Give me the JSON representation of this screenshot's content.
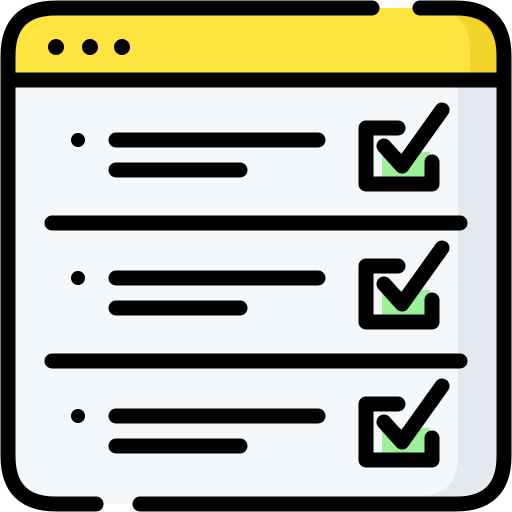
{
  "icon": {
    "name": "checklist-browser-window-icon",
    "colors": {
      "outline": "#000000",
      "title_bar": "#ffe33f",
      "title_bar_shade": "#f4d428",
      "window_body": "#f4f8fb",
      "window_shade": "#e3e9ee",
      "checkbox_fill": "#9df09a"
    },
    "window_controls": [
      "dot",
      "dot",
      "dot"
    ],
    "checklist": {
      "items": [
        {
          "checked": true,
          "bullet": true,
          "text_lines": 2
        },
        {
          "checked": true,
          "bullet": true,
          "text_lines": 2
        },
        {
          "checked": true,
          "bullet": true,
          "text_lines": 2
        }
      ]
    }
  }
}
